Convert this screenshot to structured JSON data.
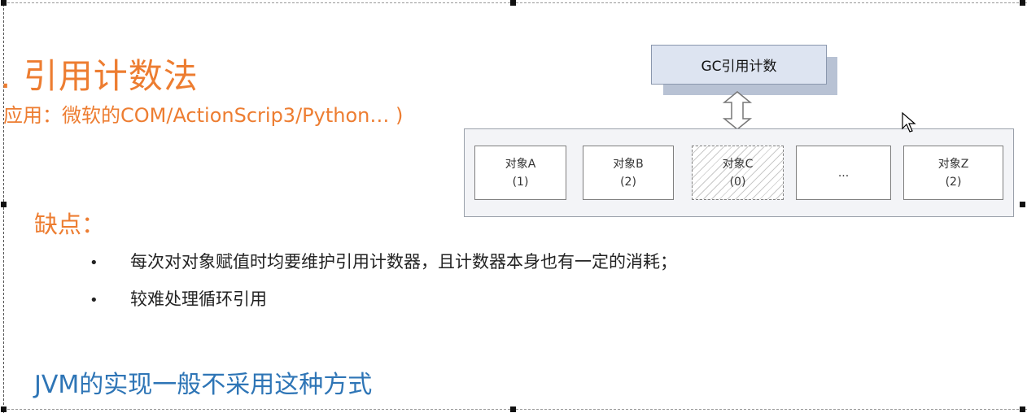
{
  "slide": {
    "title": ". 引用计数法",
    "subtitle": "应用：微软的COM/ActionScrip3/Python… )",
    "cons_heading": "缺点：",
    "bullets": [
      "每次对对象赋值时均要维护引用计数器，且计数器本身也有一定的消耗；",
      "较难处理循环引用"
    ],
    "bullet_symbol": "•",
    "conclusion": "JVM的实现一般不采用这种方式"
  },
  "diagram": {
    "gc_box_label": "GC引用计数",
    "objects": [
      {
        "name": "对象A",
        "count": "(1)"
      },
      {
        "name": "对象B",
        "count": "(2)"
      },
      {
        "name": "对象C",
        "count": "(0)"
      },
      {
        "name": "...",
        "count": ""
      },
      {
        "name": "对象Z",
        "count": "(2)"
      }
    ]
  },
  "colors": {
    "accent_orange": "#ed7d31",
    "accent_blue": "#2e75b6",
    "gc_box_fill": "#dde4f1"
  }
}
